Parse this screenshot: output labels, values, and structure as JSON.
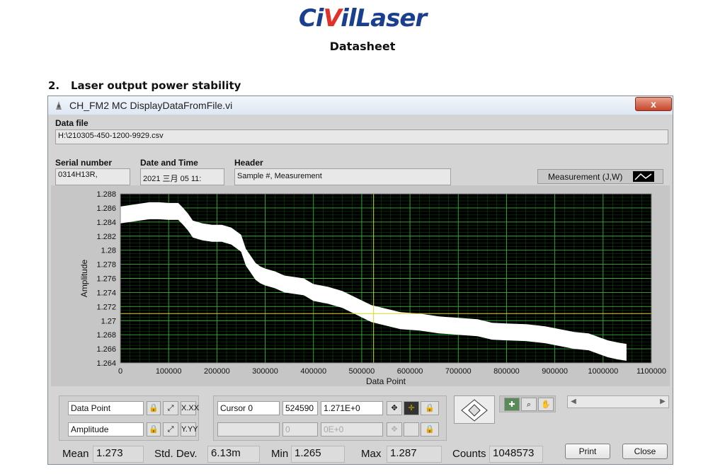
{
  "logo": {
    "part1": "Ci",
    "part2": "V",
    "part3": "ilLaser",
    "color_blue": "#1b3f8f",
    "color_red": "#e0322b"
  },
  "sheet_title": "Datasheet",
  "section": {
    "number": "2.",
    "title": "Laser output power stability"
  },
  "window": {
    "title": "CH_FM2 MC DisplayDataFromFile.vi",
    "close_label": "x",
    "data_file_label": "Data file",
    "data_file_value": "H:\\210305-450-1200-9929.csv",
    "serial_label": "Serial number",
    "serial_value": "0314H13R,",
    "datetime_label": "Date and Time",
    "datetime_value": "2021 三月 05 11:",
    "header_label": "Header",
    "header_value": "Sample #, Measurement",
    "legend_label": "Measurement (J,W)"
  },
  "chart_data": {
    "type": "line",
    "xlabel": "Data Point",
    "ylabel": "Amplitude",
    "xlim": [
      0,
      1100000
    ],
    "ylim": [
      1.264,
      1.288
    ],
    "x_ticks": [
      "0",
      "100000",
      "200000",
      "300000",
      "400000",
      "500000",
      "600000",
      "700000",
      "800000",
      "900000",
      "1000000",
      "1100000"
    ],
    "y_ticks": [
      "1.288",
      "1.286",
      "1.284",
      "1.282",
      "1.28",
      "1.278",
      "1.276",
      "1.274",
      "1.272",
      "1.27",
      "1.268",
      "1.266",
      "1.264"
    ],
    "grid": true,
    "background": "#000000",
    "grid_color": "#1f8a1f",
    "trace_color": "#ffffff",
    "cursor_color": "#d8d820",
    "cursor": {
      "x": 524590,
      "y": 1.271
    },
    "series": [
      {
        "name": "Measurement (J,W)",
        "points": [
          [
            0,
            1.285
          ],
          [
            20000,
            1.2852
          ],
          [
            40000,
            1.2854
          ],
          [
            60000,
            1.2856
          ],
          [
            80000,
            1.2856
          ],
          [
            100000,
            1.2855
          ],
          [
            120000,
            1.2855
          ],
          [
            130000,
            1.2848
          ],
          [
            140000,
            1.284
          ],
          [
            150000,
            1.283
          ],
          [
            170000,
            1.2826
          ],
          [
            190000,
            1.2824
          ],
          [
            210000,
            1.2824
          ],
          [
            230000,
            1.282
          ],
          [
            240000,
            1.2815
          ],
          [
            250000,
            1.281
          ],
          [
            260000,
            1.279
          ],
          [
            270000,
            1.278
          ],
          [
            280000,
            1.277
          ],
          [
            290000,
            1.2765
          ],
          [
            300000,
            1.2762
          ],
          [
            320000,
            1.2758
          ],
          [
            340000,
            1.2752
          ],
          [
            360000,
            1.275
          ],
          [
            380000,
            1.2748
          ],
          [
            400000,
            1.274
          ],
          [
            430000,
            1.2736
          ],
          [
            460000,
            1.273
          ],
          [
            490000,
            1.272
          ],
          [
            520000,
            1.271
          ],
          [
            550000,
            1.2705
          ],
          [
            580000,
            1.27
          ],
          [
            620000,
            1.2698
          ],
          [
            660000,
            1.2694
          ],
          [
            700000,
            1.2692
          ],
          [
            740000,
            1.269
          ],
          [
            770000,
            1.2685
          ],
          [
            800000,
            1.2684
          ],
          [
            840000,
            1.2683
          ],
          [
            880000,
            1.268
          ],
          [
            910000,
            1.2676
          ],
          [
            940000,
            1.2672
          ],
          [
            970000,
            1.267
          ],
          [
            990000,
            1.2665
          ],
          [
            1010000,
            1.266
          ],
          [
            1030000,
            1.2657
          ],
          [
            1048573,
            1.2655
          ]
        ],
        "spread": 0.0012
      }
    ]
  },
  "controls": {
    "x_axis_name": "Data Point",
    "y_axis_name": "Amplitude",
    "x_fmt": "X.XX",
    "y_fmt": "Y.YY",
    "cursor_name": "Cursor 0",
    "cursor_x": "524590",
    "cursor_y": "1.271E+0",
    "cursor2_x": "0",
    "cursor2_y": "0E+0"
  },
  "stats": {
    "mean_label": "Mean",
    "mean_value": "1.273",
    "std_label": "Std. Dev.",
    "std_value": "6.13m",
    "min_label": "Min",
    "min_value": "1.265",
    "max_label": "Max",
    "max_value": "1.287",
    "counts_label": "Counts",
    "counts_value": "1048573"
  },
  "buttons": {
    "print": "Print",
    "close": "Close"
  }
}
